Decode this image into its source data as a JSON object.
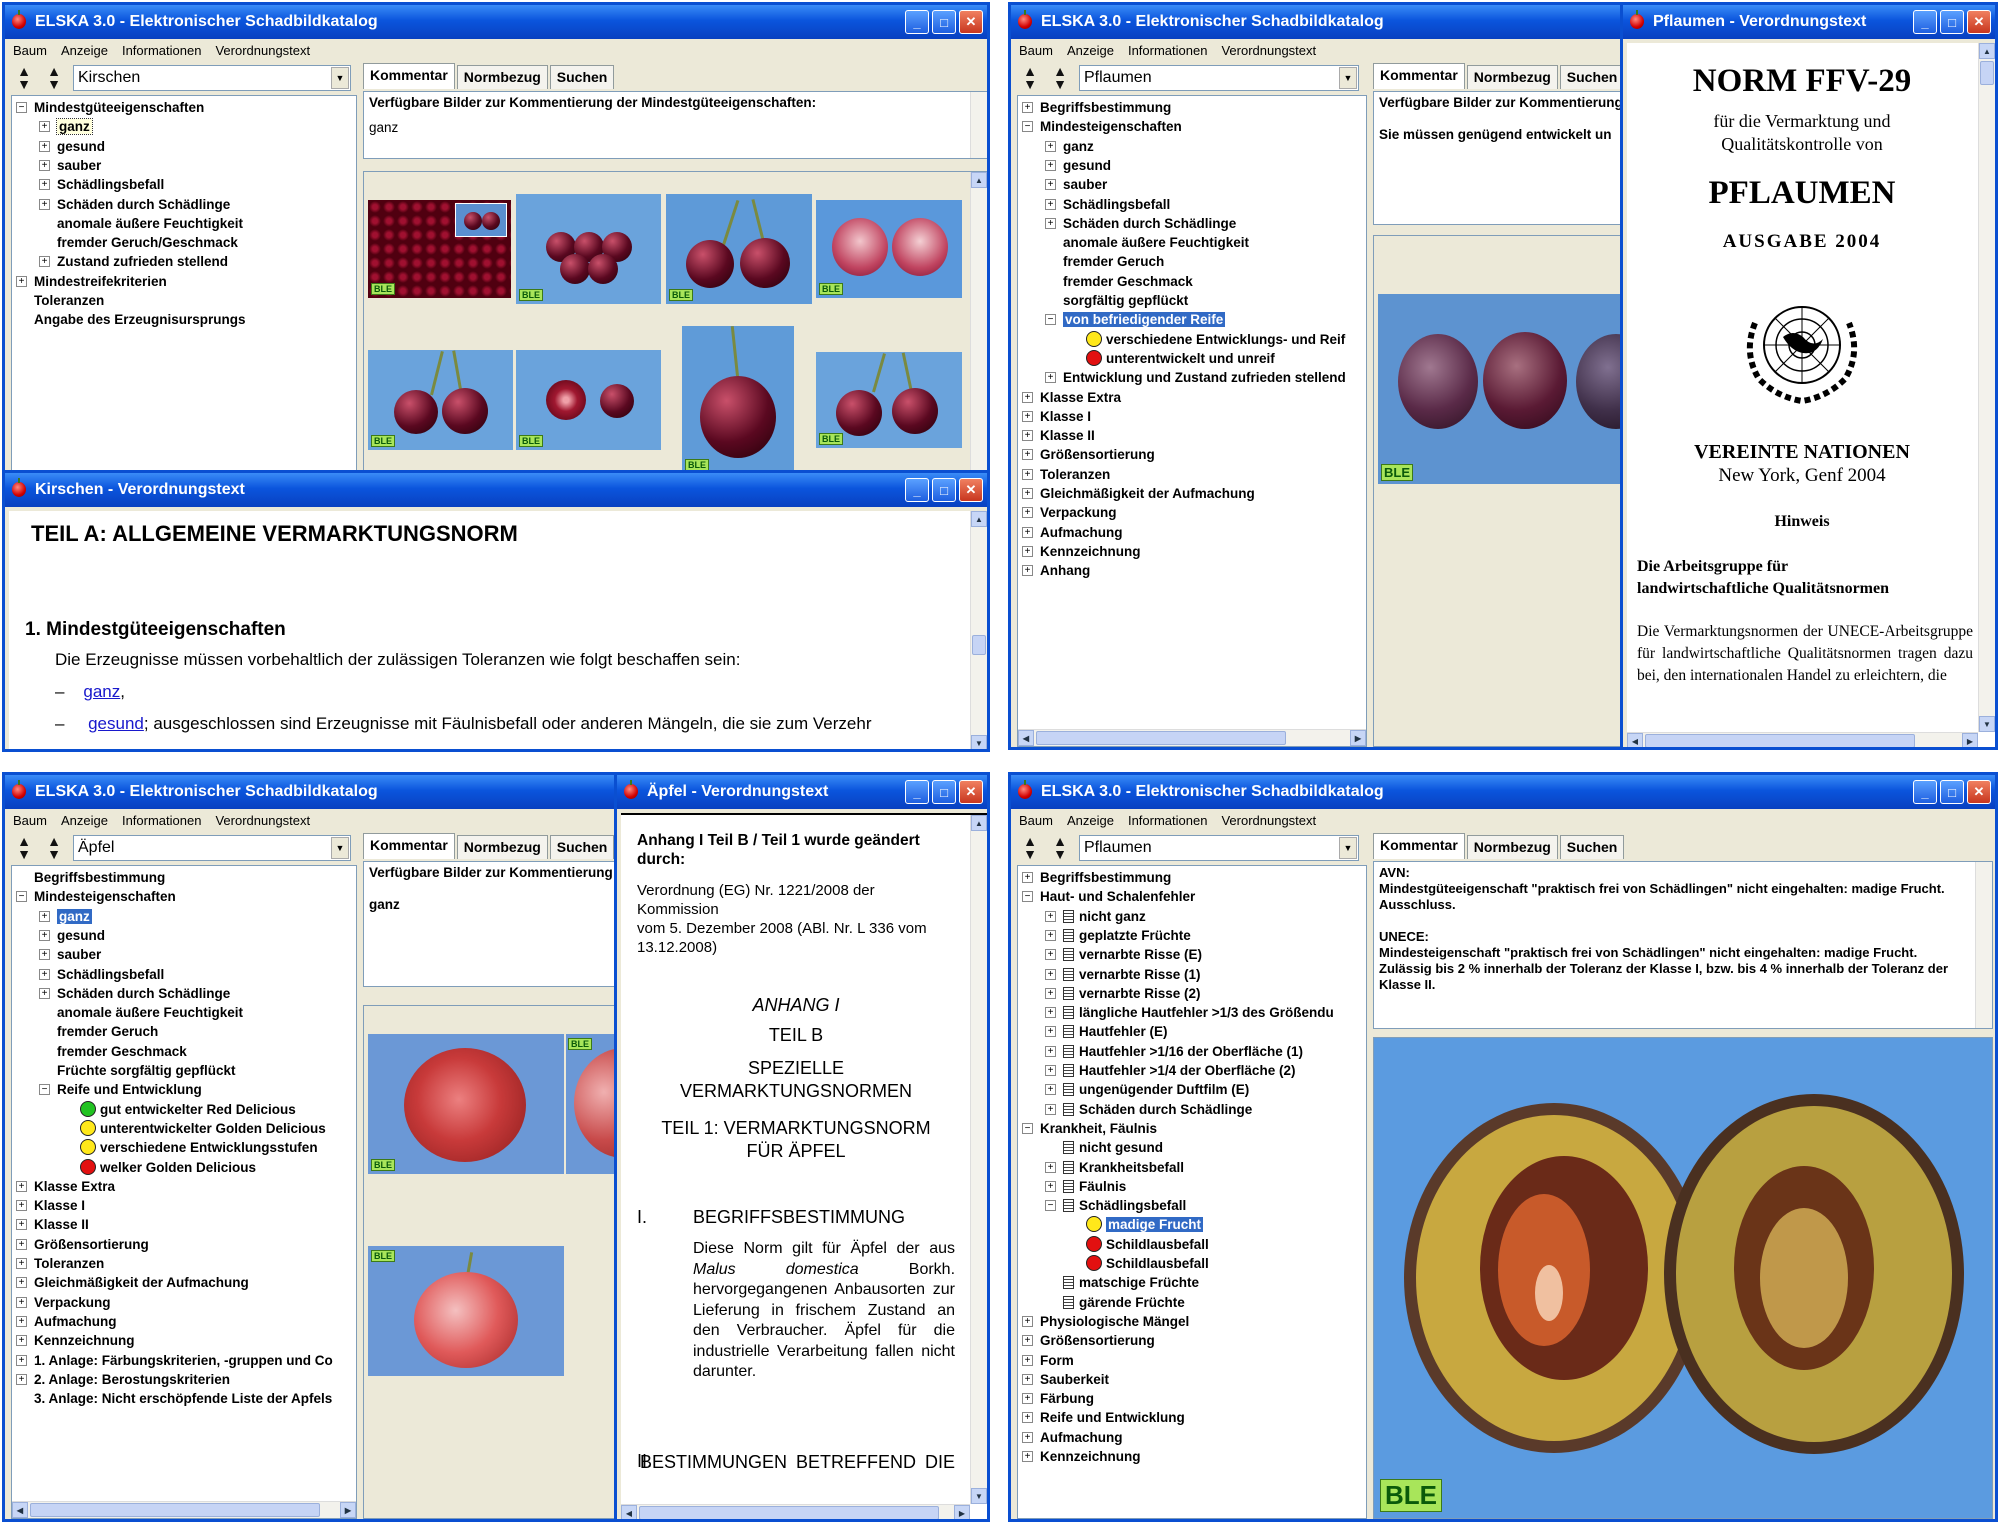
{
  "app": {
    "title": "ELSKA 3.0 - Elektronischer Schadbildkatalog",
    "menu": [
      "Baum",
      "Anzeige",
      "Informationen",
      "Verordnungstext"
    ],
    "tabs": [
      "Kommentar",
      "Normbezug",
      "Suchen"
    ],
    "ble": "BLE"
  },
  "q1": {
    "combo": "Kirschen",
    "comment_heading": "Verfügbare Bilder zur Kommentierung der Mindestgüteeigenschaften:",
    "comment_value": "ganz",
    "tree": [
      {
        "t": "Mindestgüteeigenschaften",
        "lvl": 0,
        "exp": "-"
      },
      {
        "t": "ganz",
        "lvl": 1,
        "exp": "+",
        "s": "dot"
      },
      {
        "t": "gesund",
        "lvl": 1,
        "exp": "+"
      },
      {
        "t": "sauber",
        "lvl": 1,
        "exp": "+"
      },
      {
        "t": "Schädlingsbefall",
        "lvl": 1,
        "exp": "+"
      },
      {
        "t": "Schäden durch Schädlinge",
        "lvl": 1,
        "exp": "+"
      },
      {
        "t": "anomale äußere Feuchtigkeit",
        "lvl": 1
      },
      {
        "t": "fremder Geruch/Geschmack",
        "lvl": 1
      },
      {
        "t": "Zustand zufrieden stellend",
        "lvl": 1,
        "exp": "+"
      },
      {
        "t": "Mindestreifekriterien",
        "lvl": 0,
        "exp": "+"
      },
      {
        "t": "Toleranzen",
        "lvl": 0
      },
      {
        "t": "Angabe des Erzeugnisursprungs",
        "lvl": 0
      }
    ]
  },
  "q1b": {
    "title": "Kirschen  -  Verordnungstext",
    "heading": "TEIL A:    ALLGEMEINE VERMARKTUNGSNORM",
    "section": "1.  Mindestgüteeigenschaften",
    "para": "Die Erzeugnisse müssen vorbehaltlich der zulässigen Toleranzen wie folgt beschaffen sein:",
    "dash": "–",
    "item1_link": "ganz",
    "item1_rest": ",",
    "item2_link": "gesund",
    "item2_rest": "; ausgeschlossen sind Erzeugnisse mit Fäulnisbefall oder anderen Mängeln, die sie zum Verzehr"
  },
  "q2": {
    "combo": "Pflaumen",
    "comment_heading": "Verfügbare Bilder zur Kommentierung",
    "comment_value": "Sie müssen genügend entwickelt un",
    "tree": [
      {
        "t": "Begriffsbestimmung",
        "lvl": 0,
        "exp": "+"
      },
      {
        "t": "Mindesteigenschaften",
        "lvl": 0,
        "exp": "-"
      },
      {
        "t": "ganz",
        "lvl": 1,
        "exp": "+"
      },
      {
        "t": "gesund",
        "lvl": 1,
        "exp": "+"
      },
      {
        "t": "sauber",
        "lvl": 1,
        "exp": "+"
      },
      {
        "t": "Schädlingsbefall",
        "lvl": 1,
        "exp": "+"
      },
      {
        "t": "Schäden durch Schädlinge",
        "lvl": 1,
        "exp": "+"
      },
      {
        "t": "anomale äußere Feuchtigkeit",
        "lvl": 1
      },
      {
        "t": "fremder Geruch",
        "lvl": 1
      },
      {
        "t": "fremder Geschmack",
        "lvl": 1
      },
      {
        "t": "sorgfältig gepflückt",
        "lvl": 1
      },
      {
        "t": "von befriedigender Reife",
        "lvl": 1,
        "exp": "-",
        "s": "sel"
      },
      {
        "t": "verschiedene Entwicklungs- und Reif",
        "lvl": 2,
        "f": "y"
      },
      {
        "t": "unterentwickelt und unreif",
        "lvl": 2,
        "f": "r"
      },
      {
        "t": "Entwicklung und Zustand zufrieden stellend",
        "lvl": 1,
        "exp": "+"
      },
      {
        "t": "Klasse Extra",
        "lvl": 0,
        "exp": "+"
      },
      {
        "t": "Klasse I",
        "lvl": 0,
        "exp": "+"
      },
      {
        "t": "Klasse II",
        "lvl": 0,
        "exp": "+"
      },
      {
        "t": "Größensortierung",
        "lvl": 0,
        "exp": "+"
      },
      {
        "t": "Toleranzen",
        "lvl": 0,
        "exp": "+"
      },
      {
        "t": "Gleichmäßigkeit der Aufmachung",
        "lvl": 0,
        "exp": "+"
      },
      {
        "t": "Verpackung",
        "lvl": 0,
        "exp": "+"
      },
      {
        "t": "Aufmachung",
        "lvl": 0,
        "exp": "+"
      },
      {
        "t": "Kennzeichnung",
        "lvl": 0,
        "exp": "+"
      },
      {
        "t": "Anhang",
        "lvl": 0,
        "exp": "+"
      }
    ]
  },
  "q2b": {
    "title": "Pflaumen  -  Verordnungstext",
    "norm": "NORM FFV-29",
    "sub1": "für die Vermarktung und",
    "sub2": "Qualitätskontrolle von",
    "fruit": "PFLAUMEN",
    "edition": "AUSGABE 2004",
    "org": "VEREINTE NATIONEN",
    "place": "New York, Genf 2004",
    "hinweis": "Hinweis",
    "group1": "Die Arbeitsgruppe für",
    "group2": "landwirtschaftliche Qualitätsnormen",
    "body": "Die Vermarktungsnormen der UNECE-Arbeitsgruppe für landwirtschaftliche Qualitätsnormen tragen dazu bei, den internationalen Handel zu erleichtern, die"
  },
  "q3": {
    "combo": "Äpfel",
    "comment_heading": "Verfügbare Bilder zur Kommentierung",
    "comment_value": "ganz",
    "tree": [
      {
        "t": "Begriffsbestimmung",
        "lvl": 0
      },
      {
        "t": "Mindesteigenschaften",
        "lvl": 0,
        "exp": "-"
      },
      {
        "t": "ganz",
        "lvl": 1,
        "exp": "+",
        "s": "sel"
      },
      {
        "t": "gesund",
        "lvl": 1,
        "exp": "+"
      },
      {
        "t": "sauber",
        "lvl": 1,
        "exp": "+"
      },
      {
        "t": "Schädlingsbefall",
        "lvl": 1,
        "exp": "+"
      },
      {
        "t": "Schäden durch Schädlinge",
        "lvl": 1,
        "exp": "+"
      },
      {
        "t": "anomale äußere Feuchtigkeit",
        "lvl": 1
      },
      {
        "t": "fremder Geruch",
        "lvl": 1
      },
      {
        "t": "fremder Geschmack",
        "lvl": 1
      },
      {
        "t": "Früchte sorgfältig gepflückt",
        "lvl": 1
      },
      {
        "t": "Reife und Entwicklung",
        "lvl": 1,
        "exp": "-"
      },
      {
        "t": "gut entwickelter Red Delicious",
        "lvl": 2,
        "f": "g"
      },
      {
        "t": "unterentwickelter Golden Delicious",
        "lvl": 2,
        "f": "y"
      },
      {
        "t": "verschiedene Entwicklungsstufen",
        "lvl": 2,
        "f": "y"
      },
      {
        "t": "welker Golden Delicious",
        "lvl": 2,
        "f": "r"
      },
      {
        "t": "Klasse Extra",
        "lvl": 0,
        "exp": "+"
      },
      {
        "t": "Klasse I",
        "lvl": 0,
        "exp": "+"
      },
      {
        "t": "Klasse II",
        "lvl": 0,
        "exp": "+"
      },
      {
        "t": "Größensortierung",
        "lvl": 0,
        "exp": "+"
      },
      {
        "t": "Toleranzen",
        "lvl": 0,
        "exp": "+"
      },
      {
        "t": "Gleichmäßigkeit der Aufmachung",
        "lvl": 0,
        "exp": "+"
      },
      {
        "t": "Verpackung",
        "lvl": 0,
        "exp": "+"
      },
      {
        "t": "Aufmachung",
        "lvl": 0,
        "exp": "+"
      },
      {
        "t": "Kennzeichnung",
        "lvl": 0,
        "exp": "+"
      },
      {
        "t": "1. Anlage: Färbungskriterien, -gruppen und Co",
        "lvl": 0,
        "exp": "+"
      },
      {
        "t": "2. Anlage: Berostungskriterien",
        "lvl": 0,
        "exp": "+"
      },
      {
        "t": "3. Anlage: Nicht erschöpfende Liste der Apfels",
        "lvl": 0
      }
    ]
  },
  "q3b": {
    "title": "Äpfel  -  Verordnungstext",
    "amend": "Anhang I Teil B / Teil 1 wurde geändert durch:",
    "reg1": "Verordnung (EG) Nr. 1221/2008 der Kommission",
    "reg2": "vom 5. Dezember 2008 (ABl. Nr. L 336 vom 13.12.2008)",
    "anhang": "ANHANG I",
    "teilb": "TEIL B",
    "spez": "SPEZIELLE VERMARKTUNGSNORMEN",
    "teil1": "TEIL 1: VERMARKTUNGSNORM FÜR ÄPFEL",
    "s1num": "I.",
    "s1title": "BEGRIFFSBESTIMMUNG",
    "s1a": "Diese Norm gilt für Äpfel der aus ",
    "s1b": "Malus domestica",
    "s1c": " Borkh. hervorgegangenen Anbausorten zur Lieferung in frischem Zustand an den Verbraucher. Äpfel für die industrielle Verarbeitung fallen nicht darunter.",
    "s2num": "II.",
    "s2title": "BESTIMMUNGEN BETREFFEND DIE"
  },
  "q4": {
    "combo": "Pflaumen",
    "comment_lines": [
      "AVN:",
      "Mindestgüteeigenschaft \"praktisch frei von Schädlingen\" nicht eingehalten: madige Frucht.",
      "Ausschluss.",
      "",
      "UNECE:",
      "Mindesteigenschaft \"praktisch frei von Schädlingen\" nicht eingehalten: madige Frucht.",
      "Zulässig bis 2 % innerhalb der Toleranz der Klasse I, bzw. bis 4 % innerhalb der Toleranz der Klasse II."
    ],
    "tree": [
      {
        "t": "Begriffsbestimmung",
        "lvl": 0,
        "exp": "+"
      },
      {
        "t": "Haut- und Schalenfehler",
        "lvl": 0,
        "exp": "-"
      },
      {
        "t": "nicht ganz",
        "lvl": 1,
        "exp": "+",
        "d": 1
      },
      {
        "t": "geplatzte Früchte",
        "lvl": 1,
        "exp": "+",
        "d": 1
      },
      {
        "t": "vernarbte Risse (E)",
        "lvl": 1,
        "exp": "+",
        "d": 1
      },
      {
        "t": "vernarbte Risse (1)",
        "lvl": 1,
        "exp": "+",
        "d": 1
      },
      {
        "t": "vernarbte Risse (2)",
        "lvl": 1,
        "exp": "+",
        "d": 1
      },
      {
        "t": "längliche Hautfehler >1/3 des Größendu",
        "lvl": 1,
        "exp": "+",
        "d": 1
      },
      {
        "t": "Hautfehler (E)",
        "lvl": 1,
        "exp": "+",
        "d": 1
      },
      {
        "t": "Hautfehler >1/16 der Oberfläche (1)",
        "lvl": 1,
        "exp": "+",
        "d": 1
      },
      {
        "t": "Hautfehler >1/4 der Oberfläche (2)",
        "lvl": 1,
        "exp": "+",
        "d": 1
      },
      {
        "t": "ungenügender Duftfilm (E)",
        "lvl": 1,
        "exp": "+",
        "d": 1
      },
      {
        "t": "Schäden durch Schädlinge",
        "lvl": 1,
        "exp": "+",
        "d": 1
      },
      {
        "t": "Krankheit, Fäulnis",
        "lvl": 0,
        "exp": "-"
      },
      {
        "t": "nicht gesund",
        "lvl": 1,
        "d": 1
      },
      {
        "t": "Krankheitsbefall",
        "lvl": 1,
        "exp": "+",
        "d": 1
      },
      {
        "t": "Fäulnis",
        "lvl": 1,
        "exp": "+",
        "d": 1
      },
      {
        "t": "Schädlingsbefall",
        "lvl": 1,
        "exp": "-",
        "d": 1
      },
      {
        "t": "madige Frucht",
        "lvl": 2,
        "f": "y",
        "s": "sel"
      },
      {
        "t": "Schildlausbefall",
        "lvl": 2,
        "f": "r"
      },
      {
        "t": "Schildlausbefall",
        "lvl": 2,
        "f": "r"
      },
      {
        "t": "matschige Früchte",
        "lvl": 1,
        "d": 1
      },
      {
        "t": "gärende Früchte",
        "lvl": 1,
        "d": 1
      },
      {
        "t": "Physiologische Mängel",
        "lvl": 0,
        "exp": "+"
      },
      {
        "t": "Größensortierung",
        "lvl": 0,
        "exp": "+"
      },
      {
        "t": "Form",
        "lvl": 0,
        "exp": "+"
      },
      {
        "t": "Sauberkeit",
        "lvl": 0,
        "exp": "+"
      },
      {
        "t": "Färbung",
        "lvl": 0,
        "exp": "+"
      },
      {
        "t": "Reife und Entwicklung",
        "lvl": 0,
        "exp": "+"
      },
      {
        "t": "Aufmachung",
        "lvl": 0,
        "exp": "+"
      },
      {
        "t": "Kennzeichnung",
        "lvl": 0,
        "exp": "+"
      }
    ]
  }
}
